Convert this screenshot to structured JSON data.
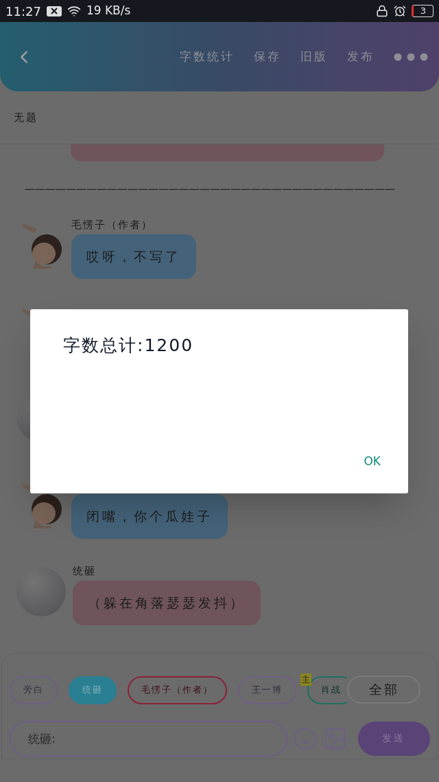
{
  "status_bar": {
    "time": "11:27",
    "speed": "19 KB/s",
    "battery": "3"
  },
  "header": {
    "actions": [
      "字数统计",
      "保存",
      "旧版",
      "发布"
    ]
  },
  "title": "无题",
  "messages": [
    {
      "kind": "cut_bubble",
      "color": "#6f5459"
    },
    {
      "kind": "divider",
      "text": "————————————————————————————————————"
    },
    {
      "kind": "message",
      "name": "毛愣子（作者）",
      "text": "哎呀，不写了",
      "color": "#44637a"
    },
    {
      "kind": "hidden"
    },
    {
      "kind": "hidden",
      "avatar": {
        "kind": "plain"
      }
    },
    {
      "kind": "message",
      "text": "闭嘴，你个瓜娃子",
      "color": "#44637a"
    },
    {
      "kind": "message",
      "avatar": {
        "kind": "plain"
      },
      "name": "统砸",
      "text": "（躲在角落瑟瑟发抖）",
      "color": "#6f5459"
    }
  ],
  "roles": [
    {
      "label": "旁白",
      "color": "#6e5f85",
      "selected": false
    },
    {
      "label": "统砸",
      "color": "#2a7f92",
      "selected": true
    },
    {
      "label": "毛愣子（作者）",
      "color": "#8a2238",
      "selected": false
    },
    {
      "label": "王一博",
      "color": "#6e5f85",
      "selected": false
    },
    {
      "label": "肖战",
      "color": "#1f6f60",
      "selected": false,
      "badge": "主"
    }
  ],
  "all_button": "全部",
  "input": {
    "placeholder": "统砸:"
  },
  "send_button": "发送",
  "dialog": {
    "message": "字数总计:1200",
    "ok": "OK"
  }
}
